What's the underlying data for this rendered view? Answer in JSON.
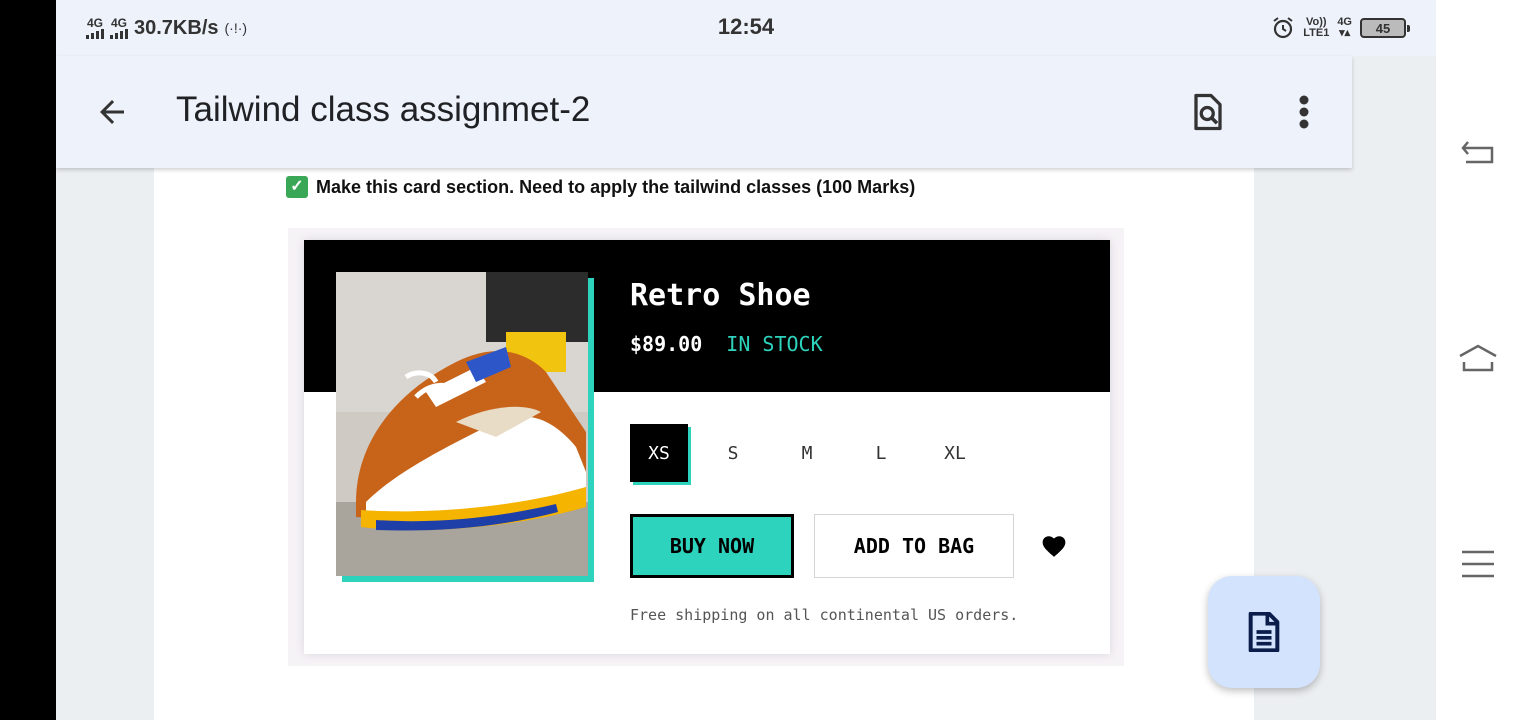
{
  "status_bar": {
    "network_1": "4G",
    "network_2": "4G",
    "speed": "30.7KB/s",
    "time": "12:54",
    "volte": "Vo))",
    "lte": "LTE1",
    "network_3": "4G",
    "battery": "45"
  },
  "app_bar": {
    "title": "Tailwind class assignmet-2"
  },
  "document": {
    "instruction": "Make this card section. Need to apply the tailwind classes (100 Marks)"
  },
  "card": {
    "title": "Retro Shoe",
    "price": "$89.00",
    "stock": "IN STOCK",
    "sizes": [
      "XS",
      "S",
      "M",
      "L",
      "XL"
    ],
    "selected_size": "XS",
    "buy_label": "BUY NOW",
    "bag_label": "ADD TO BAG",
    "shipping": "Free shipping on all continental US orders."
  },
  "colors": {
    "accent": "#2ed3bd",
    "app_bar_bg": "#eef2fb",
    "fab_bg": "#d3e3fd"
  },
  "icons": {
    "back": "arrow-left-icon",
    "search_doc": "find-in-page-icon",
    "more": "more-vert-icon",
    "fab": "document-icon",
    "favorite": "heart-icon",
    "nav_back": "back-icon",
    "nav_home": "home-icon",
    "nav_menu": "menu-icon"
  }
}
